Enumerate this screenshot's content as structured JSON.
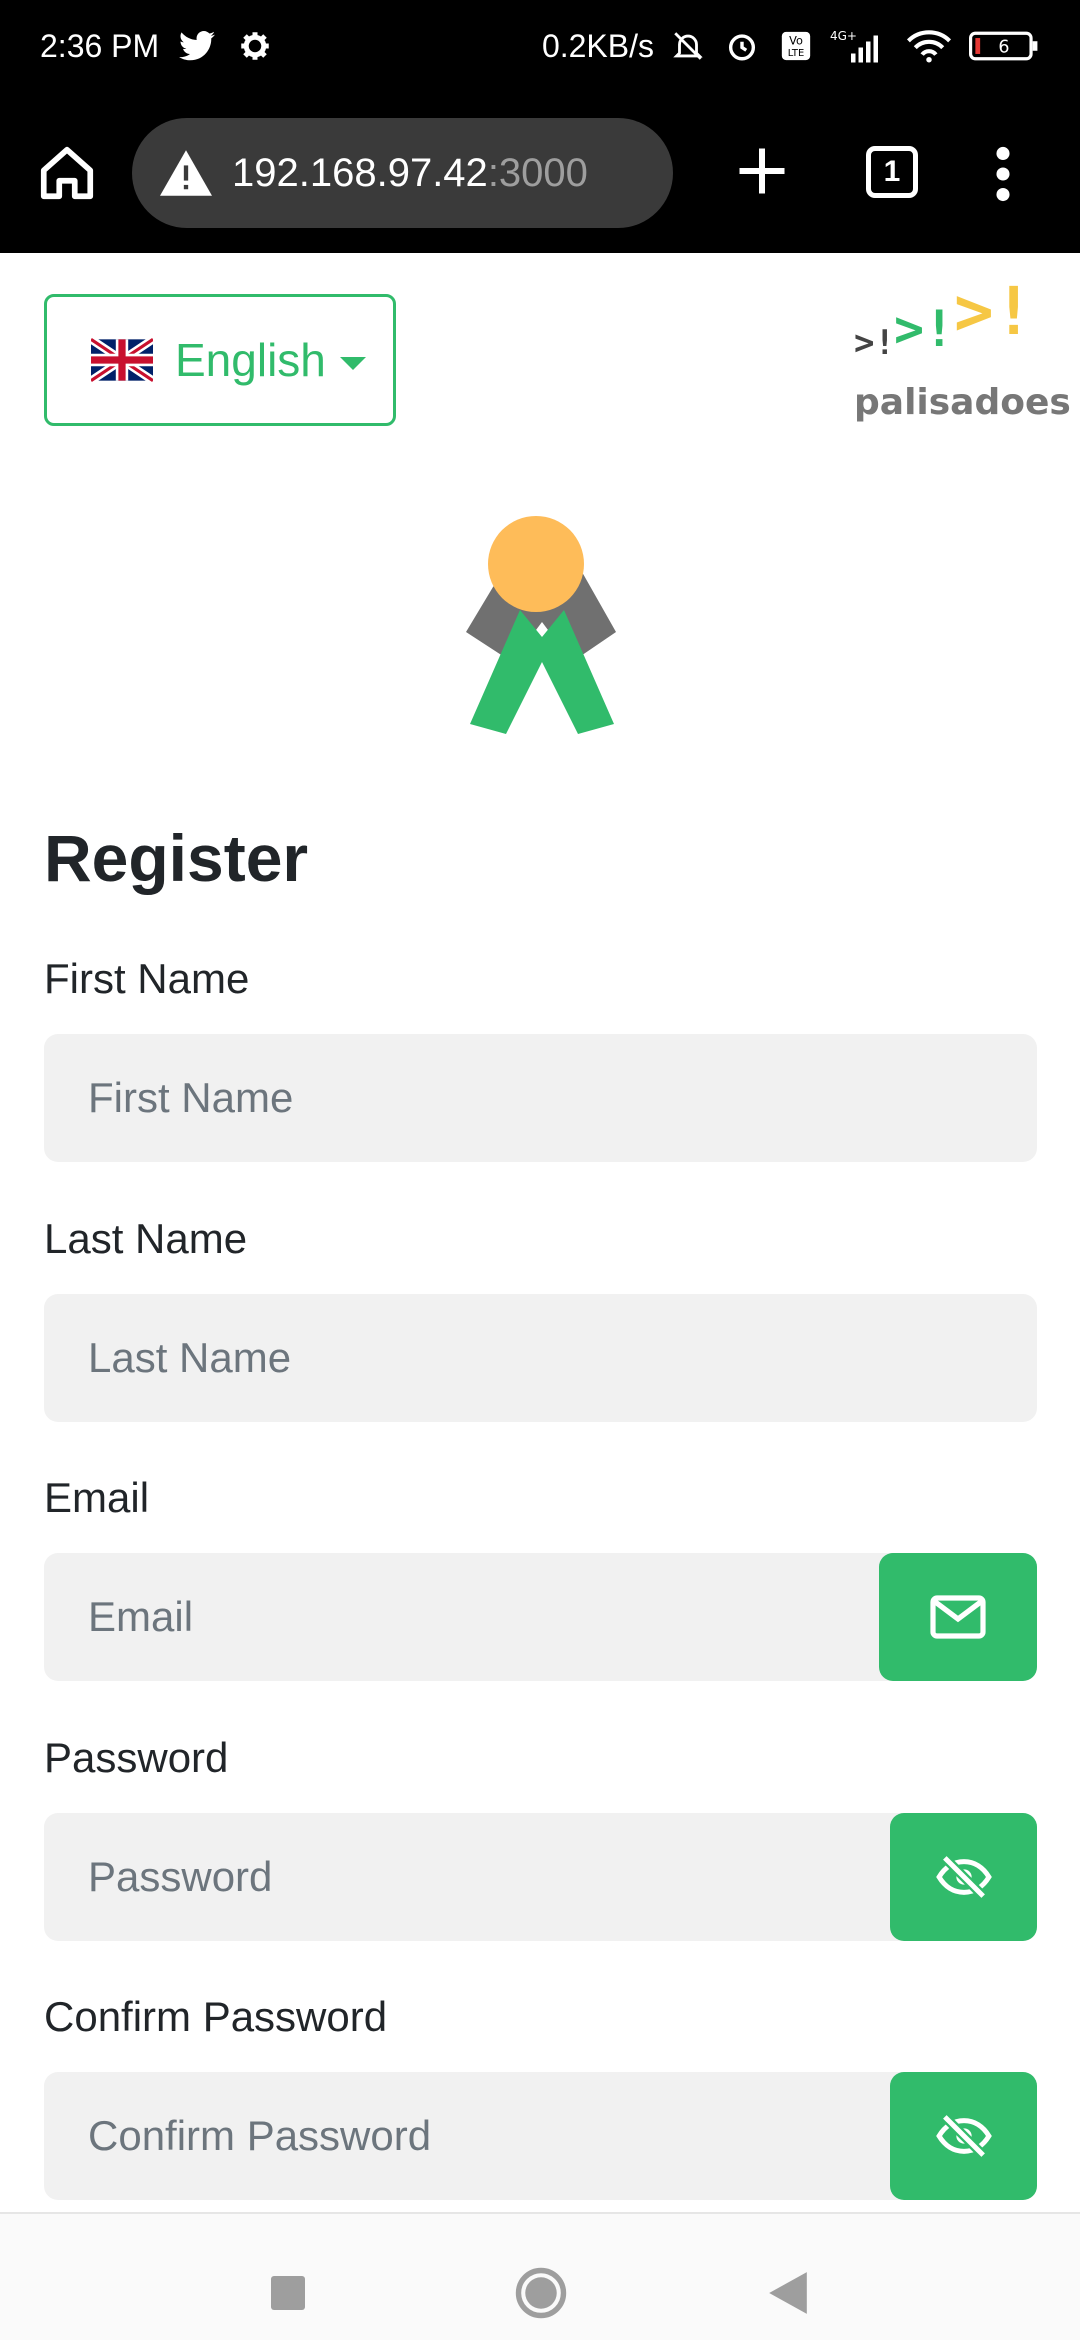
{
  "status_bar": {
    "time": "2:36 PM",
    "net_speed": "0.2KB/s",
    "battery": "6",
    "icons": [
      "twitter-icon",
      "settings-icon",
      "mute-icon",
      "alarm-icon",
      "volte-icon",
      "signal-4g-icon",
      "wifi-icon",
      "battery-icon"
    ]
  },
  "browser": {
    "url_host": "192.168.97.42",
    "url_port": ":3000",
    "tab_count": "1"
  },
  "language": {
    "selected": "English",
    "flag": "uk-flag-icon"
  },
  "brand": {
    "name": "palisadoes",
    "mark": ">!>!>!",
    "colors": {
      "green": "#31bb6b",
      "yellow": "#febc59"
    }
  },
  "form": {
    "title": "Register",
    "fields": {
      "first_name": {
        "label": "First Name",
        "placeholder": "First Name"
      },
      "last_name": {
        "label": "Last Name",
        "placeholder": "Last Name"
      },
      "email": {
        "label": "Email",
        "placeholder": "Email"
      },
      "password": {
        "label": "Password",
        "placeholder": "Password"
      },
      "confirm_password": {
        "label": "Confirm Password",
        "placeholder": "Confirm Password"
      }
    }
  },
  "theme": {
    "accent": "#31bb6b",
    "input_bg": "#f1f1f1"
  }
}
